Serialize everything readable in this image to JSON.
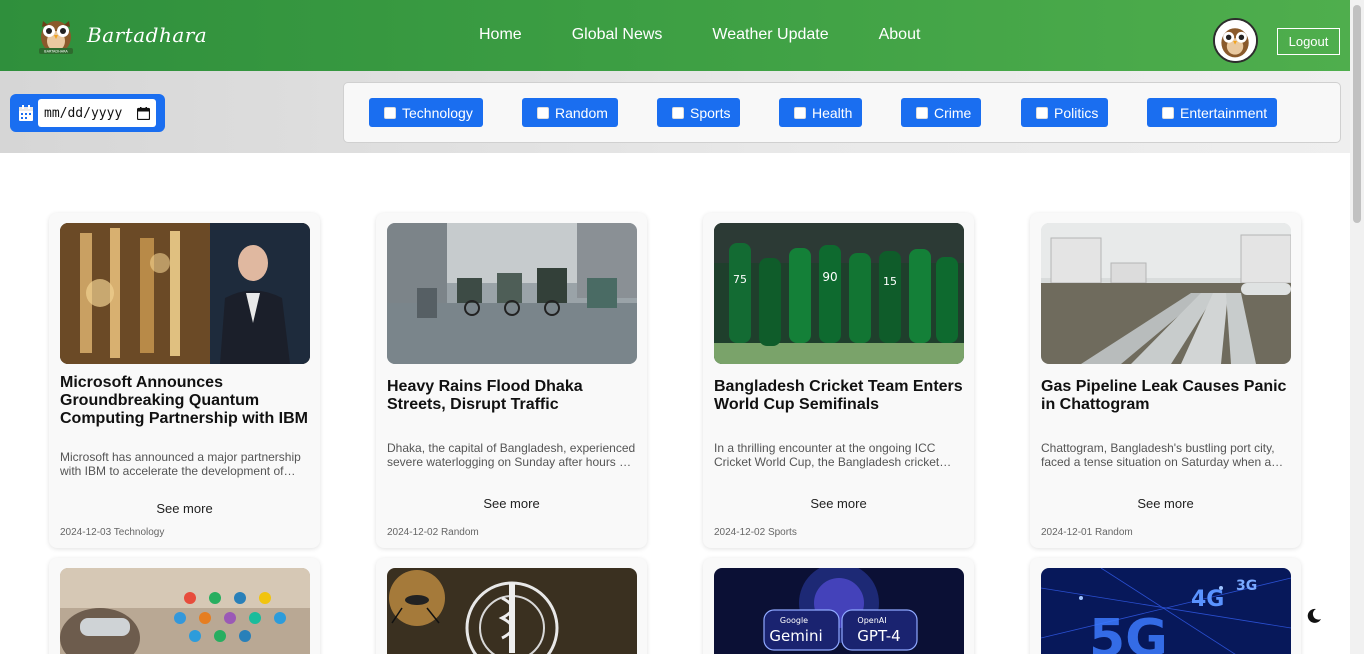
{
  "brand": {
    "name": "Bartadhara",
    "logo_text": "BARTADHARA"
  },
  "nav": [
    "Home",
    "Global News",
    "Weather Update",
    "About"
  ],
  "header": {
    "logout_label": "Logout"
  },
  "filters": {
    "date_placeholder": "mm/dd/yyyy",
    "categories": [
      "Technology",
      "Random",
      "Sports",
      "Health",
      "Crime",
      "Politics",
      "Entertainment"
    ]
  },
  "articles": [
    {
      "title": "Microsoft Announces Groundbreaking Quantum Computing Partnership with IBM",
      "excerpt": "Microsoft has announced a major partnership with IBM to accelerate the development of…",
      "see_more": "See more",
      "date": "2024-12-03",
      "category": "Technology"
    },
    {
      "title": "Heavy Rains Flood Dhaka Streets, Disrupt Traffic",
      "excerpt": "Dhaka, the capital of Bangladesh, experienced severe waterlogging on Sunday after hours …",
      "see_more": "See more",
      "date": "2024-12-02",
      "category": "Random"
    },
    {
      "title": "Bangladesh Cricket Team Enters World Cup Semifinals",
      "excerpt": "In a thrilling encounter at the ongoing ICC Cricket World Cup, the Bangladesh cricket…",
      "see_more": "See more",
      "date": "2024-12-02",
      "category": "Sports"
    },
    {
      "title": "Gas Pipeline Leak Causes Panic in Chattogram",
      "excerpt": "Chattogram, Bangladesh's bustling port city, faced a tense situation on Saturday when a…",
      "see_more": "See more",
      "date": "2024-12-01",
      "category": "Random"
    }
  ],
  "lower_cards": {
    "c3_image_text": [
      "Google",
      "Gemini",
      "OpenAI",
      "GPT-4"
    ],
    "c4_image_text": [
      "5G",
      "4G",
      "3G"
    ]
  },
  "icons": {
    "calendar": "calendar-icon",
    "dark_mode": "moon-icon"
  }
}
